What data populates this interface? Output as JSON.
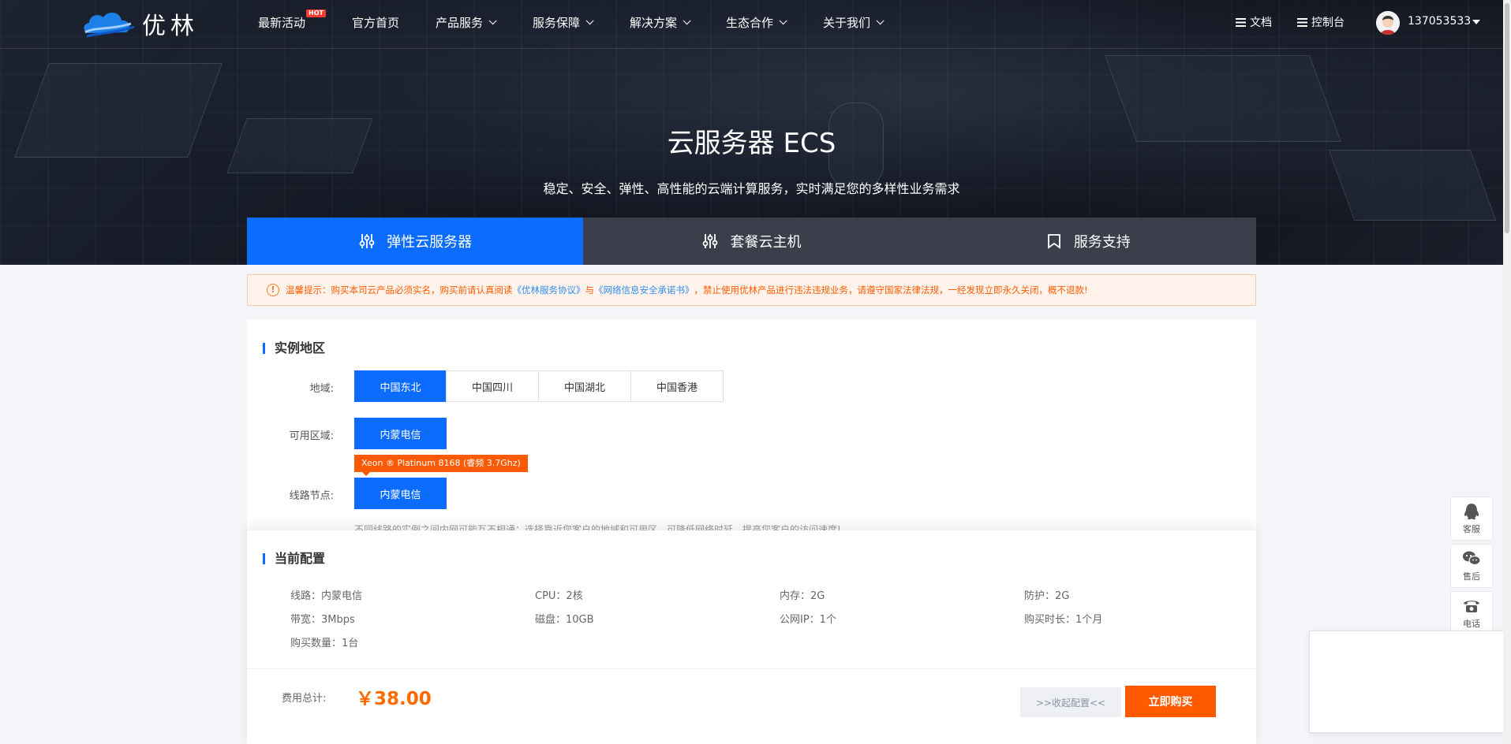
{
  "brand": {
    "logo_text": "优林"
  },
  "nav": {
    "items": [
      {
        "label": "最新活动",
        "badge": "HOT",
        "dropdown": false
      },
      {
        "label": "官方首页",
        "dropdown": false
      },
      {
        "label": "产品服务",
        "dropdown": true
      },
      {
        "label": "服务保障",
        "dropdown": true
      },
      {
        "label": "解决方案",
        "dropdown": true
      },
      {
        "label": "生态合作",
        "dropdown": true
      },
      {
        "label": "关于我们",
        "dropdown": true
      }
    ],
    "docs_label": "文档",
    "console_label": "控制台",
    "username": "137053533"
  },
  "hero": {
    "title": "云服务器 ECS",
    "subtitle": "稳定、安全、弹性、高性能的云端计算服务，实时满足您的多样性业务需求"
  },
  "tabs": [
    {
      "label": "弹性云服务器",
      "active": true,
      "icon": "sliders-icon"
    },
    {
      "label": "套餐云主机",
      "active": false,
      "icon": "sliders-icon"
    },
    {
      "label": "服务支持",
      "active": false,
      "icon": "bookmark-icon"
    }
  ],
  "notice": {
    "prefix": "温馨提示：购买本司云产品必须实名，购买前请认真阅读",
    "link1": "《优林服务协议》",
    "mid": "与",
    "link2": "《网络信息安全承诺书》",
    "suffix": "，禁止使用优林产品进行违法违规业务，请遵守国家法律法规，一经发现立即永久关闭，概不退款!"
  },
  "instance": {
    "section_title": "实例地区",
    "region_label": "地域:",
    "regions": [
      "中国东北",
      "中国四川",
      "中国湖北",
      "中国香港"
    ],
    "selected_region": "中国东北",
    "zone_label": "可用区域:",
    "zone": "内蒙电信",
    "cpu_tag": "Xeon ® Platinum 8168 (睿频 3.7Ghz)",
    "line_label": "线路节点:",
    "line": "内蒙电信",
    "hint": "不同线路的实例之间内网可能互不相通；选择靠近您客户的地域和可用区，可降低网络时延、提高您客户的访问速度!"
  },
  "config": {
    "section_title": "当前配置",
    "items": [
      "线路：内蒙电信",
      "CPU：2核",
      "内存：2G",
      "防护：2G",
      "带宽：3Mbps",
      "磁盘：10GB",
      "公网IP：1个",
      "购买时长：1个月",
      "购买数量：1台"
    ],
    "total_label": "费用总计:",
    "price": "￥38.00",
    "collapse_label": ">>收起配置<<",
    "buy_label": "立即购买"
  },
  "float": {
    "qq_label": "客服",
    "wechat_label": "售后",
    "phone_label": "电话"
  },
  "colors": {
    "primary": "#0b6cff",
    "accent": "#ff5a00"
  }
}
